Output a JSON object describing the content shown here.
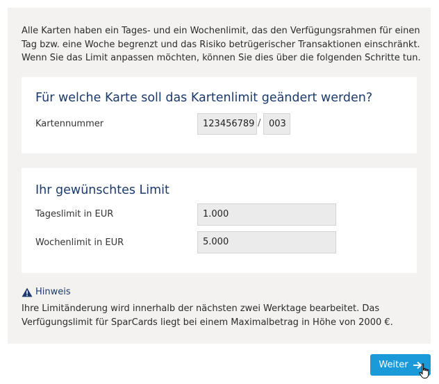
{
  "intro_text": "Alle Karten haben ein Tages- und ein Wochenlimit, das den Verfügungsrahmen für einen Tag bzw. eine Woche begrenzt und das Risiko betrügerischer Transaktionen einschränkt. Wenn Sie das Limit anpassen möchten, können Sie dies über die folgenden Schritte tun.",
  "card_section": {
    "title": "Für welche Karte soll das Kartenlimit geändert werden?",
    "card_number_label": "Kartennummer",
    "card_number_value": "123456789",
    "separator": "/",
    "card_suffix_value": "003"
  },
  "limit_section": {
    "title": "Ihr gewünschtes Limit",
    "daily_label": "Tageslimit in EUR",
    "daily_value": "1.000",
    "weekly_label": "Wochenlimit in EUR",
    "weekly_value": "5.000"
  },
  "notice": {
    "icon": "warning-icon",
    "title": "Hinweis",
    "text": "Ihre Limitänderung wird innerhalb der nächsten zwei Werktage bearbeitet. Das Verfügungslimit für SparCards liegt bei einem Maximalbetrag in Höhe von 2000 €."
  },
  "next_button": {
    "label": "Weiter",
    "icon": "arrow-right-icon"
  },
  "colors": {
    "panel_background": "#f3f2f0",
    "heading": "#1b3a6b",
    "button": "#1a9ad9"
  }
}
